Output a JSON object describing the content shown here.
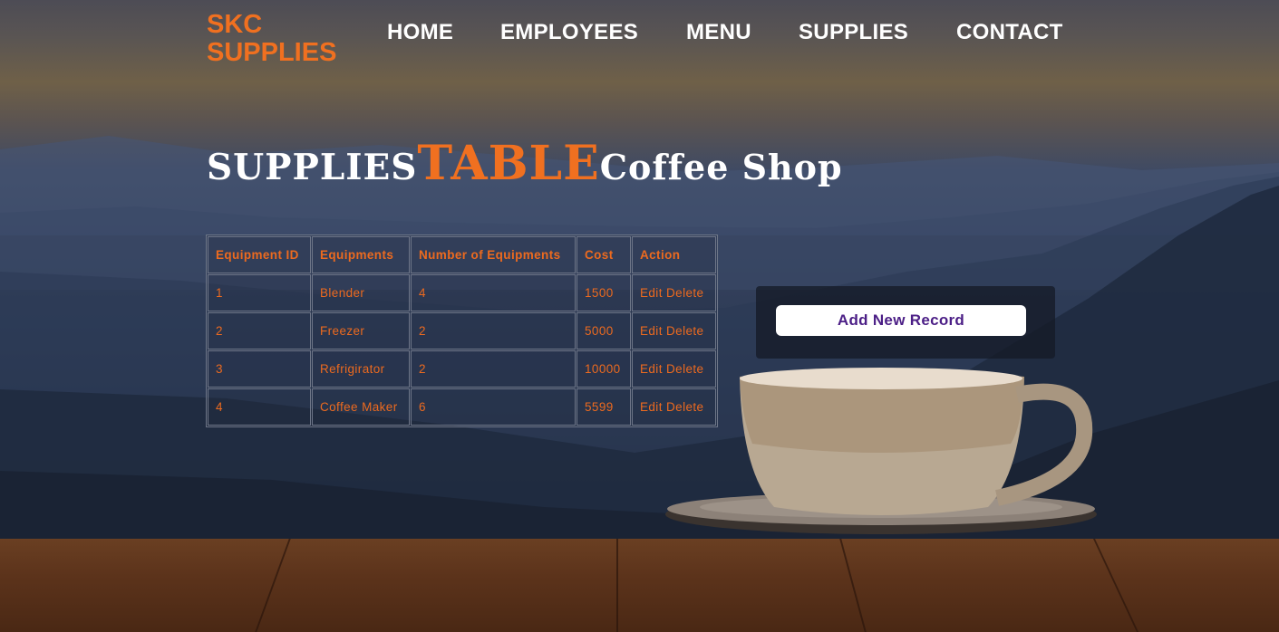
{
  "brand": {
    "line1": "SKC",
    "line2": "SUPPLIES"
  },
  "nav": [
    {
      "label": "HOME"
    },
    {
      "label": "EMPLOYEES"
    },
    {
      "label": "MENU"
    },
    {
      "label": "SUPPLIES"
    },
    {
      "label": "CONTACT"
    }
  ],
  "title": {
    "part1": "SUPPLIES",
    "part2": "TABLE",
    "part3": "Coffee Shop"
  },
  "table": {
    "headers": [
      "Equipment ID",
      "Equipments",
      "Number of Equipments",
      "Cost",
      "Action"
    ],
    "rows": [
      {
        "id": "1",
        "equipment": "Blender",
        "count": "4",
        "cost": "1500",
        "edit": "Edit",
        "delete": "Delete"
      },
      {
        "id": "2",
        "equipment": "Freezer",
        "count": "2",
        "cost": "5000",
        "edit": "Edit",
        "delete": "Delete"
      },
      {
        "id": "3",
        "equipment": "Refrigirator",
        "count": "2",
        "cost": "10000",
        "edit": "Edit",
        "delete": "Delete"
      },
      {
        "id": "4",
        "equipment": "Coffee Maker",
        "count": "6",
        "cost": "5599",
        "edit": "Edit",
        "delete": "Delete"
      }
    ]
  },
  "add_record": {
    "label": "Add New Record"
  },
  "colors": {
    "accent": "#f07020",
    "nav_text": "#ffffff",
    "button_text": "#4b1e86"
  }
}
